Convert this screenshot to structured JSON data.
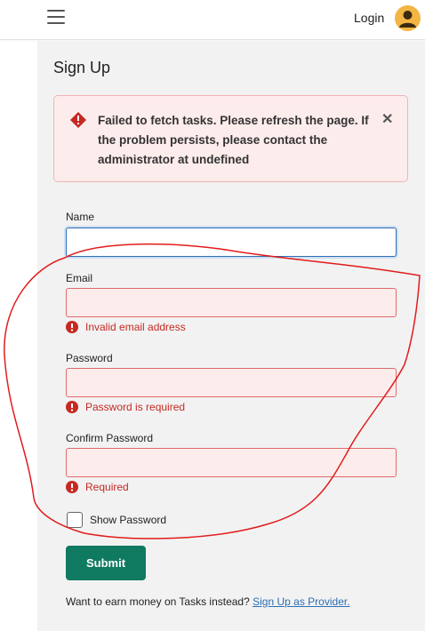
{
  "header": {
    "login_label": "Login"
  },
  "page": {
    "title": "Sign Up"
  },
  "alert": {
    "message": "Failed to fetch tasks. Please refresh the page. If the problem persists, please contact the administrator at undefined",
    "close_glyph": "✕"
  },
  "form": {
    "name_label": "Name",
    "name_value": "",
    "email_label": "Email",
    "email_error": "Invalid email address",
    "password_label": "Password",
    "password_error": "Password is required",
    "confirm_label": "Confirm Password",
    "confirm_error": "Required",
    "show_password_label": "Show Password",
    "submit_label": "Submit"
  },
  "footer": {
    "prompt": "Want to earn money on Tasks instead?",
    "link_label": "Sign Up as Provider."
  },
  "colors": {
    "accent": "#0f7a60",
    "error": "#c52a23",
    "link": "#2d6fb5",
    "annotation": "#e21b1b"
  }
}
